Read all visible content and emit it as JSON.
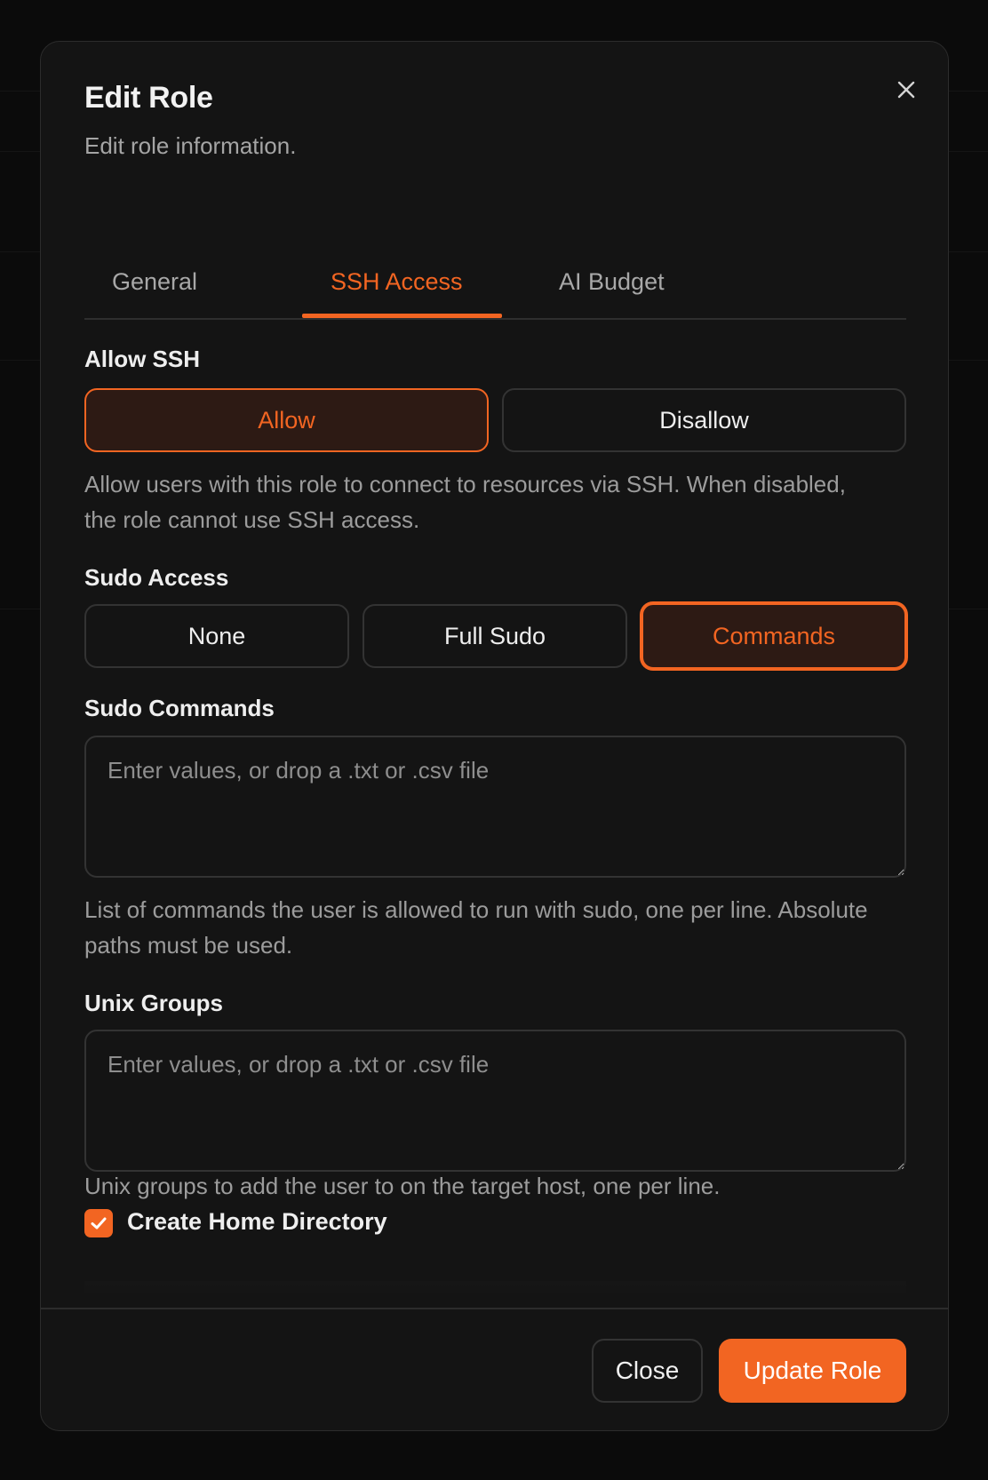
{
  "dialog": {
    "title": "Edit Role",
    "subtitle": "Edit role information."
  },
  "tabs": [
    {
      "label": "General",
      "active": false
    },
    {
      "label": "SSH Access",
      "active": true
    },
    {
      "label": "AI Budget",
      "active": false
    }
  ],
  "allow_ssh": {
    "label": "Allow SSH",
    "options": [
      "Allow",
      "Disallow"
    ],
    "selected": "Allow",
    "help": "Allow users with this role to connect to resources via SSH. When disabled, the role cannot use SSH access."
  },
  "sudo_access": {
    "label": "Sudo Access",
    "options": [
      "None",
      "Full Sudo",
      "Commands"
    ],
    "selected": "Commands"
  },
  "sudo_commands": {
    "label": "Sudo Commands",
    "placeholder": "Enter values, or drop a .txt or .csv file",
    "value": "",
    "help": "List of commands the user is allowed to run with sudo, one per line. Absolute paths must be used."
  },
  "unix_groups": {
    "label": "Unix Groups",
    "placeholder": "Enter values, or drop a .txt or .csv file",
    "value": "",
    "help": "Unix groups to add the user to on the target host, one per line."
  },
  "create_home": {
    "label": "Create Home Directory",
    "checked": true
  },
  "footer": {
    "close_label": "Close",
    "update_label": "Update Role"
  },
  "colors": {
    "accent": "#f26522",
    "background": "#141414",
    "selected_fill": "#2d1a14",
    "border": "#333333"
  },
  "icons": {
    "close": "close-icon",
    "check": "check-icon"
  }
}
